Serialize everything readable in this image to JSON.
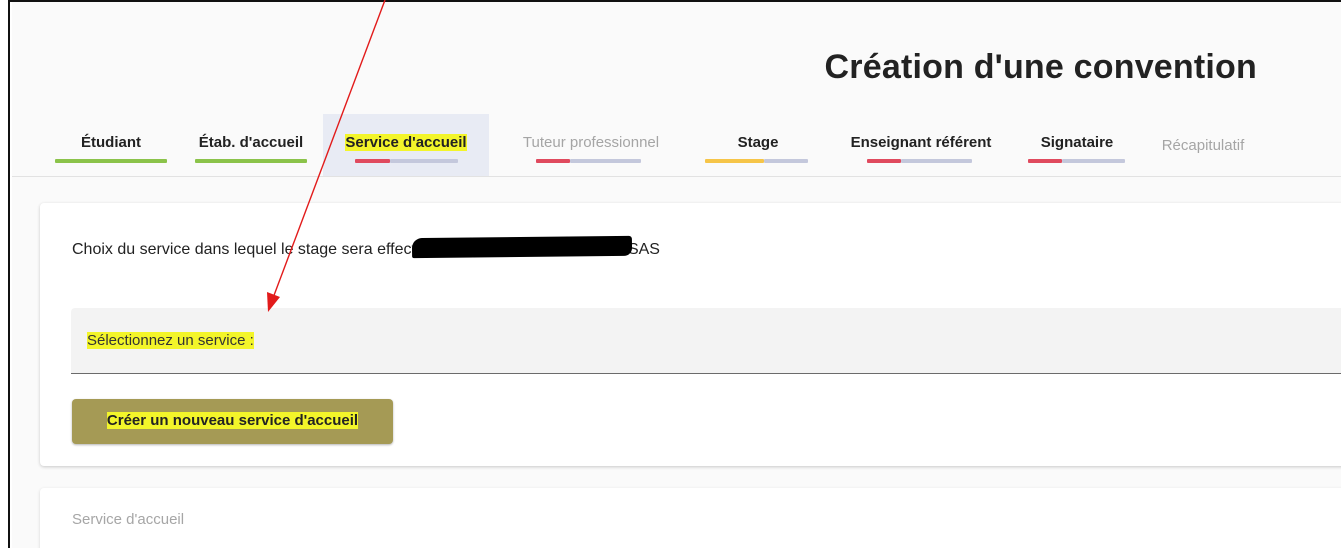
{
  "page": {
    "title": "Création d'une convention"
  },
  "tabs": [
    {
      "label": "Étudiant",
      "bar": [
        "#8bc34a",
        "#8bc34a"
      ]
    },
    {
      "label": "Étab. d'accueil",
      "bar": [
        "#8bc34a",
        "#8bc34a"
      ]
    },
    {
      "label": "Service d'accueil",
      "bar": [
        "#e04a5e",
        "#c4c8dc"
      ]
    },
    {
      "label": "Tuteur professionnel",
      "bar": [
        "#e04a5e",
        "#c4c8dc"
      ]
    },
    {
      "label": "Stage",
      "bar": [
        "#f6c548",
        "#c4c8dc"
      ]
    },
    {
      "label": "Enseignant référent",
      "bar": [
        "#e04a5e",
        "#c4c8dc"
      ]
    },
    {
      "label": "Signataire",
      "bar": [
        "#e04a5e",
        "#c4c8dc"
      ]
    },
    {
      "label": "Récapitulatif",
      "bar": []
    }
  ],
  "service_card": {
    "description": "Choix du service dans lequel le stage sera effectué - Établissement d'accueil : SAS",
    "select_label": "Sélectionnez un service :",
    "create_button": "Créer un nouveau service d'accueil"
  },
  "section2": {
    "label": "Service d'accueil"
  },
  "colors": {
    "highlight": "#f3f52a",
    "button": "#a59a55",
    "arrow": "#e21b1b",
    "active_tab_bg": "#e8ebf4"
  },
  "annotation": {
    "icon": "arrow-icon"
  }
}
